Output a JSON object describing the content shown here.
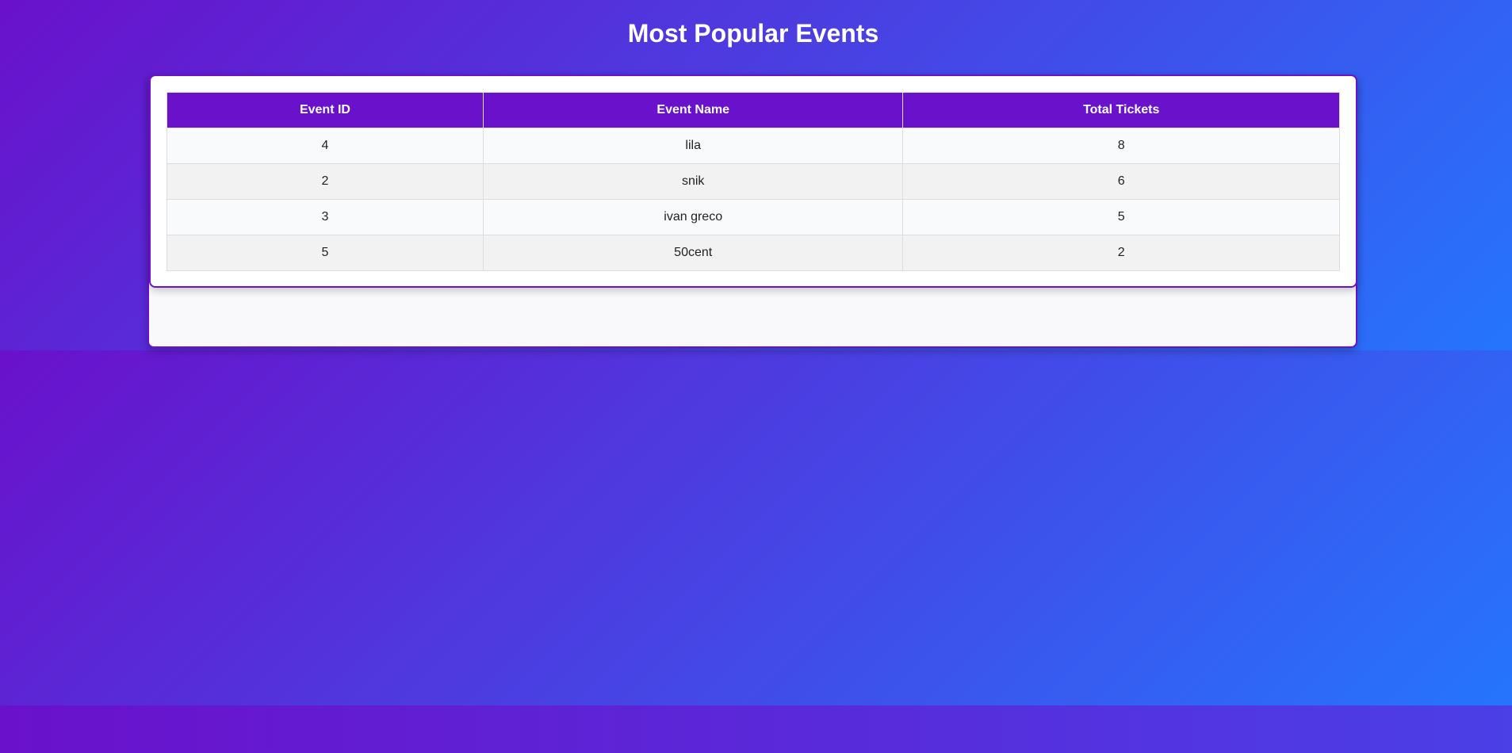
{
  "page": {
    "title": "Most Popular Events"
  },
  "table": {
    "headers": [
      "Event ID",
      "Event Name",
      "Total Tickets"
    ],
    "rows": [
      {
        "id": "4",
        "name": "lila",
        "total": "8"
      },
      {
        "id": "2",
        "name": "snik",
        "total": "6"
      },
      {
        "id": "3",
        "name": "ivan greco",
        "total": "5"
      },
      {
        "id": "5",
        "name": "50cent",
        "total": "2"
      }
    ]
  },
  "colors": {
    "header_bg": "#6a11cb",
    "gradient_start": "#6a11cb",
    "gradient_end": "#2575fc"
  }
}
